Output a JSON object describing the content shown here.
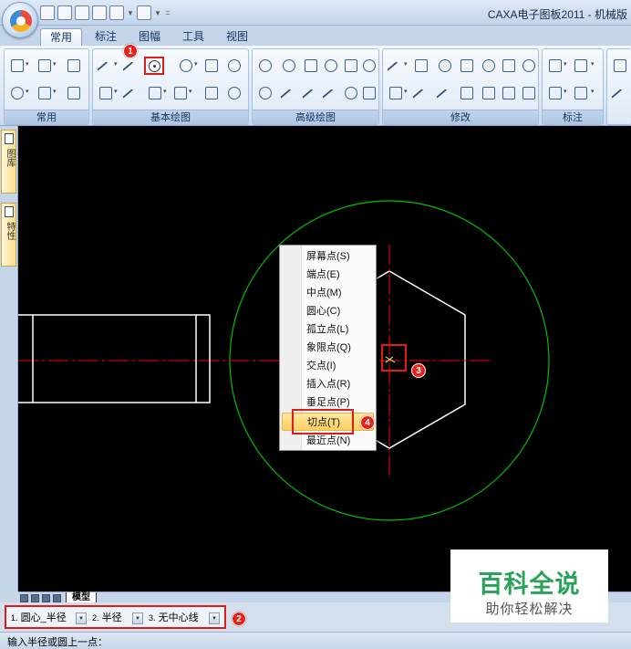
{
  "window": {
    "title": "CAXA电子图板2011 - 机械版"
  },
  "ribbon": {
    "tabs": [
      "常用",
      "标注",
      "图幅",
      "工具",
      "视图"
    ],
    "active_tab": "常用",
    "groups": [
      "常用",
      "基本绘图",
      "高级绘图",
      "修改",
      "标注"
    ]
  },
  "sidepanel": {
    "tabs": [
      "图库",
      "特性"
    ]
  },
  "context_menu": {
    "items": [
      "屏幕点(S)",
      "端点(E)",
      "中点(M)",
      "圆心(C)",
      "孤立点(L)",
      "象限点(Q)",
      "交点(I)",
      "插入点(R)",
      "垂足点(P)",
      "切点(T)",
      "最近点(N)"
    ],
    "highlighted": "切点(T)"
  },
  "model_tab": {
    "label": "模型"
  },
  "command_options": [
    {
      "num": "1.",
      "value": "圆心_半径"
    },
    {
      "num": "2.",
      "value": "半径"
    },
    {
      "num": "3.",
      "value": "无中心线"
    }
  ],
  "status": {
    "prompt": "输入半径或圆上一点："
  },
  "annotations": [
    "1",
    "2",
    "3",
    "4"
  ],
  "watermark": {
    "title": "百科全说",
    "subtitle": "助你轻松解决"
  },
  "colors": {
    "canvas": "#000000",
    "circle": "#00c000",
    "center_line": "#ff0000",
    "geometry": "#ffffff",
    "highlight_box": "#e01b1b",
    "watermark_green": "#2aa35a"
  },
  "icons": [
    "app-orb-icon",
    "circle-icon",
    "line-icon",
    "cursor-icon"
  ]
}
